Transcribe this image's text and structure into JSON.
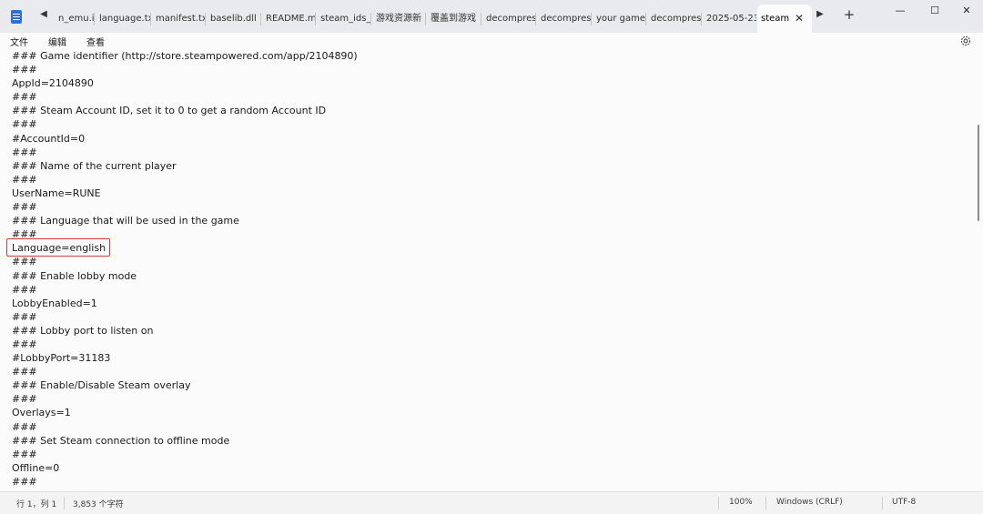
{
  "titlebar": {
    "app_icon": "notepad-icon",
    "tab_scroll_left": "◀",
    "tab_scroll_right": "▶",
    "new_tab": "+",
    "tabs": [
      {
        "label": "n_emu.i"
      },
      {
        "label": "language.txt"
      },
      {
        "label": "manifest.txt"
      },
      {
        "label": "baselib.dll"
      },
      {
        "label": "README.md"
      },
      {
        "label": "steam_ids_cc"
      },
      {
        "label": "游戏资源新"
      },
      {
        "label": "覆盖到游戏"
      },
      {
        "label": "decompress_"
      },
      {
        "label": "decompress_"
      },
      {
        "label": "your game c"
      },
      {
        "label": "decompress_"
      },
      {
        "label": "2025-05-23"
      },
      {
        "label": "steam",
        "active": true
      }
    ],
    "close_tab": "✕",
    "window_controls": {
      "minimize": "—",
      "maximize": "☐",
      "close": "✕"
    }
  },
  "menu": {
    "file": "文件",
    "edit": "编辑",
    "view": "查看",
    "settings_icon": "gear-icon"
  },
  "editor": {
    "lines": [
      "### Game identifier (http://store.steampowered.com/app/2104890)",
      "###",
      "AppId=2104890",
      "###",
      "### Steam Account ID, set it to 0 to get a random Account ID",
      "###",
      "#AccountId=0",
      "###",
      "### Name of the current player",
      "###",
      "UserName=RUNE",
      "###",
      "### Language that will be used in the game",
      "###",
      "Language=english",
      "###",
      "### Enable lobby mode",
      "###",
      "LobbyEnabled=1",
      "###",
      "### Lobby port to listen on",
      "###",
      "#LobbyPort=31183",
      "###",
      "### Enable/Disable Steam overlay",
      "###",
      "Overlays=1",
      "###",
      "### Set Steam connection to offline mode",
      "###",
      "Offline=0",
      "###"
    ],
    "highlight_color": "#d23b3b"
  },
  "status": {
    "position": "行 1，列 1",
    "char_count": "3,853 个字符",
    "zoom": "100%",
    "line_ending": "Windows (CRLF)",
    "encoding": "UTF-8"
  }
}
